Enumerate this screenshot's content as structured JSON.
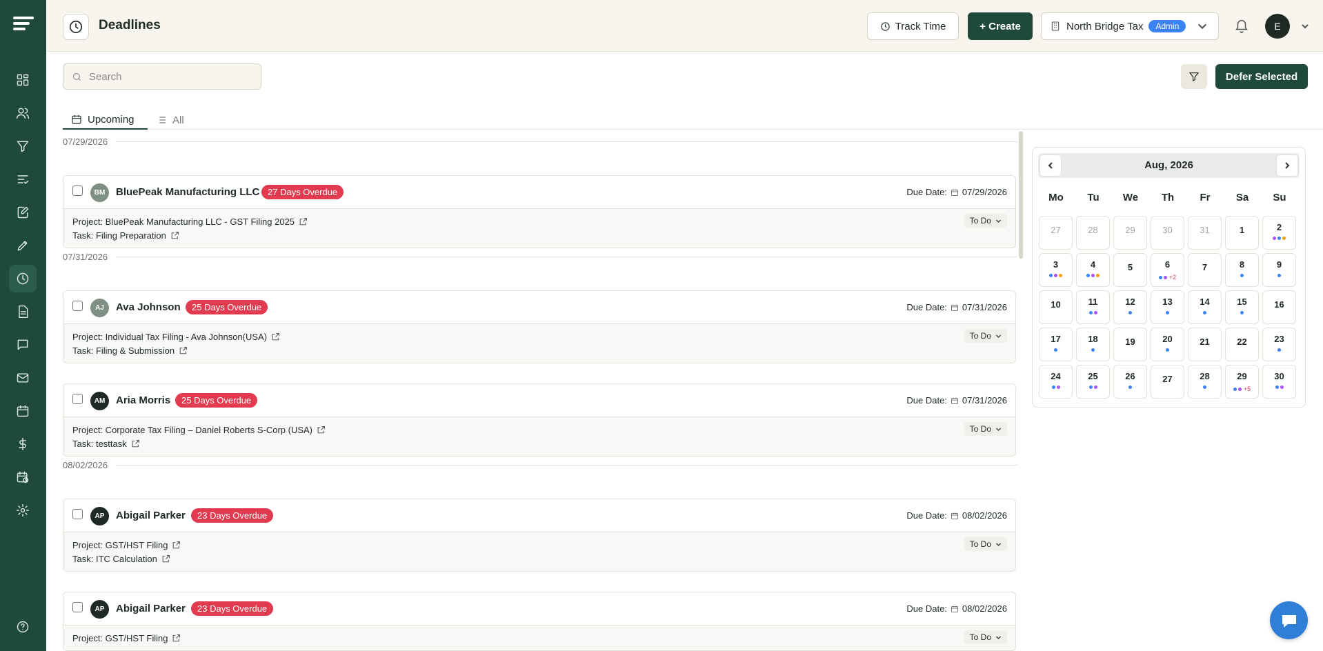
{
  "app": {
    "page_title": "Deadlines"
  },
  "header": {
    "track_time_label": "Track Time",
    "create_label": "+ Create",
    "org_name": "North Bridge Tax",
    "org_role": "Admin",
    "user_initial": "E"
  },
  "toolbar": {
    "search_placeholder": "Search",
    "defer_label": "Defer Selected"
  },
  "tabs": [
    {
      "label": "Upcoming",
      "active": true
    },
    {
      "label": "All",
      "active": false
    }
  ],
  "colors": {
    "brand": "#1f4a3b",
    "overdue": "#e23a4e",
    "dot_blue": "#3b82f6",
    "dot_purple": "#a855f7",
    "dot_orange": "#f59e0b"
  },
  "groups": [
    {
      "date": "07/29/2026",
      "cards": [
        {
          "initials": "BM",
          "avatar_color": "#7e8f84",
          "client": "BluePeak Manufacturing LLC",
          "overdue": "27 Days Overdue",
          "due_label": "Due Date:",
          "due": "07/29/2026",
          "project": "Project: BluePeak Manufacturing LLC - GST Filing 2025",
          "task": "Task: Filing Preparation",
          "status": "To Do"
        }
      ]
    },
    {
      "date": "07/31/2026",
      "cards": [
        {
          "initials": "AJ",
          "avatar_color": "#7e8f84",
          "client": "Ava Johnson",
          "overdue": "25 Days Overdue",
          "due_label": "Due Date:",
          "due": "07/31/2026",
          "project": "Project: Individual Tax Filing - Ava Johnson(USA)",
          "task": "Task: Filing & Submission",
          "status": "To Do"
        },
        {
          "initials": "AM",
          "avatar_color": "#1f2a24",
          "client": "Aria Morris",
          "overdue": "25 Days Overdue",
          "due_label": "Due Date:",
          "due": "07/31/2026",
          "project": "Project: Corporate Tax Filing – Daniel Roberts S-Corp (USA)",
          "task": "Task: testtask",
          "status": "To Do"
        }
      ]
    },
    {
      "date": "08/02/2026",
      "cards": [
        {
          "initials": "AP",
          "avatar_color": "#1f2a24",
          "client": "Abigail Parker",
          "overdue": "23 Days Overdue",
          "due_label": "Due Date:",
          "due": "08/02/2026",
          "project": "Project: GST/HST Filing",
          "task": "Task: ITC Calculation",
          "status": "To Do"
        },
        {
          "initials": "AP",
          "avatar_color": "#1f2a24",
          "client": "Abigail Parker",
          "overdue": "23 Days Overdue",
          "due_label": "Due Date:",
          "due": "08/02/2026",
          "project": "Project: GST/HST Filing",
          "task": "",
          "status": "To Do"
        }
      ]
    }
  ],
  "calendar": {
    "month_label": "Aug, 2026",
    "weekdays": [
      "Mo",
      "Tu",
      "We",
      "Th",
      "Fr",
      "Sa",
      "Su"
    ],
    "days": [
      {
        "n": "27",
        "out": true,
        "dots": []
      },
      {
        "n": "28",
        "out": true,
        "dots": []
      },
      {
        "n": "29",
        "out": true,
        "dots": []
      },
      {
        "n": "30",
        "out": true,
        "dots": []
      },
      {
        "n": "31",
        "out": true,
        "dots": []
      },
      {
        "n": "1",
        "dots": []
      },
      {
        "n": "2",
        "dots": [
          "purple",
          "blue",
          "orange"
        ]
      },
      {
        "n": "3",
        "dots": [
          "blue",
          "purple",
          "orange"
        ]
      },
      {
        "n": "4",
        "dots": [
          "blue",
          "purple",
          "orange"
        ]
      },
      {
        "n": "5",
        "dots": []
      },
      {
        "n": "6",
        "dots": [
          "blue",
          "purple"
        ],
        "more": "+2"
      },
      {
        "n": "7",
        "dots": []
      },
      {
        "n": "8",
        "dots": [
          "blue"
        ]
      },
      {
        "n": "9",
        "dots": [
          "blue"
        ]
      },
      {
        "n": "10",
        "dots": []
      },
      {
        "n": "11",
        "dots": [
          "blue",
          "purple"
        ]
      },
      {
        "n": "12",
        "dots": [
          "blue"
        ]
      },
      {
        "n": "13",
        "dots": [
          "blue"
        ]
      },
      {
        "n": "14",
        "dots": [
          "blue"
        ]
      },
      {
        "n": "15",
        "dots": [
          "blue"
        ]
      },
      {
        "n": "16",
        "dots": []
      },
      {
        "n": "17",
        "dots": [
          "blue"
        ]
      },
      {
        "n": "18",
        "dots": [
          "blue"
        ]
      },
      {
        "n": "19",
        "dots": []
      },
      {
        "n": "20",
        "dots": [
          "blue"
        ]
      },
      {
        "n": "21",
        "dots": []
      },
      {
        "n": "22",
        "dots": []
      },
      {
        "n": "23",
        "dots": [
          "blue"
        ]
      },
      {
        "n": "24",
        "dots": [
          "blue",
          "purple"
        ]
      },
      {
        "n": "25",
        "dots": [
          "blue",
          "purple"
        ]
      },
      {
        "n": "26",
        "dots": [
          "blue"
        ]
      },
      {
        "n": "27",
        "dots": []
      },
      {
        "n": "28",
        "dots": [
          "blue"
        ]
      },
      {
        "n": "29",
        "dots": [
          "blue",
          "purple"
        ],
        "more": "+5"
      },
      {
        "n": "30",
        "dots": [
          "blue",
          "purple"
        ]
      }
    ]
  },
  "sidebar": {
    "items": [
      {
        "name": "dashboard-icon"
      },
      {
        "name": "users-icon"
      },
      {
        "name": "filter-icon"
      },
      {
        "name": "task-list-icon"
      },
      {
        "name": "edit-document-icon"
      },
      {
        "name": "pen-icon"
      },
      {
        "name": "clock-icon",
        "active": true
      },
      {
        "name": "document-icon"
      },
      {
        "name": "chat-icon"
      },
      {
        "name": "mail-icon"
      },
      {
        "name": "calendar-icon"
      },
      {
        "name": "dollar-icon"
      },
      {
        "name": "calendar-clock-icon"
      },
      {
        "name": "settings-icon"
      },
      {
        "name": "help-icon"
      }
    ]
  }
}
